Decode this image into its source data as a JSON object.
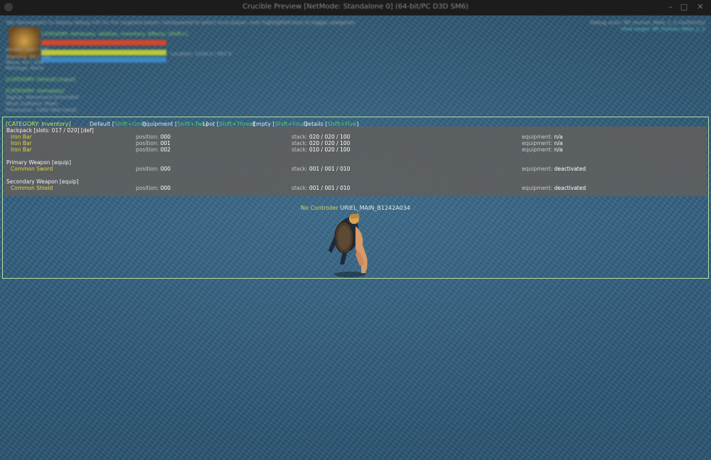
{
  "window": {
    "title": "Crucible Preview [NetMode: Standalone 0] (64-bit/PC D3D SM6)"
  },
  "hud": {
    "debug_lines": [
      "Tab (Nameplate) to display debug info for the targeted player; UseSpawnId to select local player; over highlighted keys to toggle categories",
      "CATEGORY: Attributes, Abilities, Inventory, Effects; [Shift+]",
      "Health: 100 / 100",
      "Stamina: 80 / 100",
      "Mana: 60 / 100",
      "Location: 1234.0 / 567.0",
      "Montage: None",
      "[CATEGORY: Default] [Input]",
      "[CATEGORY: Gameplay]",
      "Tag/Up: Movement:Grounded",
      "Move Collision: Pawn",
      "Possession: 1000 (Not Used)"
    ],
    "debug_right": [
      "Debug actor: BP_Human_Male_C_0 (Authority)",
      "View target: BP_Human_Male_C_0"
    ]
  },
  "inventory_panel": {
    "category_label": "[CATEGORY: Inventory]",
    "tabs": [
      {
        "label": "Default",
        "key": "Shift+One"
      },
      {
        "label": "Equipment",
        "key": "Shift+Two"
      },
      {
        "label": "Loot",
        "key": "Shift+Three"
      },
      {
        "label": "Empty",
        "key": "Shift+Four"
      },
      {
        "label": "Details",
        "key": "Shift+Five"
      }
    ],
    "sections": [
      {
        "title": "Backpack [slots: 017 / 020] [def]",
        "items": [
          {
            "name": "Iron Bar",
            "position": "000",
            "stack": "020 / 020 / 100",
            "equipment": "n/a"
          },
          {
            "name": "Iron Bar",
            "position": "001",
            "stack": "020 / 020 / 100",
            "equipment": "n/a"
          },
          {
            "name": "Iron Bar",
            "position": "002",
            "stack": "010 / 020 / 100",
            "equipment": "n/a"
          }
        ]
      },
      {
        "title": "Primary Weapon [equip]",
        "items": [
          {
            "name": "Common Sword",
            "position": "000",
            "stack": "001 / 001 / 010",
            "equipment": "deactivated"
          }
        ]
      },
      {
        "title": "Secondary Weapon [equip]",
        "items": [
          {
            "name": "Common Shield",
            "position": "000",
            "stack": "001 / 001 / 010",
            "equipment": "deactivated"
          }
        ]
      }
    ],
    "field_labels": {
      "position": "position:",
      "stack": "stack:",
      "equipment": "equipment:"
    }
  },
  "character": {
    "controller_text": "No Controller",
    "actor_id": "URIEL_MAIN_B1242A034"
  },
  "colors": {
    "panel_border": "#b7dca0",
    "item_name": "#e0d34a",
    "key_hint": "#58c86a",
    "category": "#cfe45a"
  }
}
